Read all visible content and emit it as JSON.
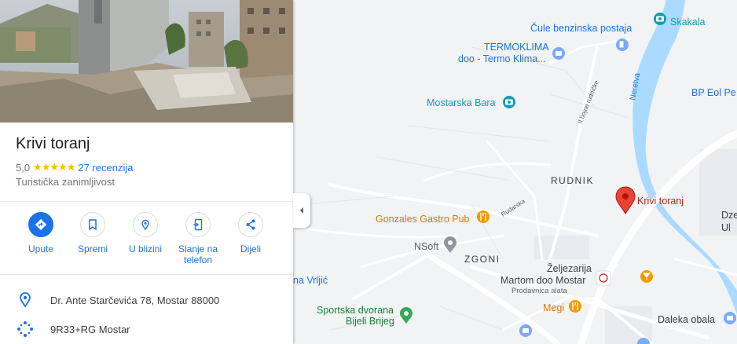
{
  "place": {
    "name": "Krivi toranj",
    "rating": "5,0",
    "stars": "★★★★★",
    "reviews": "27 recenzija",
    "category": "Turistička zanimljivost"
  },
  "actions": [
    {
      "label": "Upute",
      "icon": "directions-icon"
    },
    {
      "label": "Spremi",
      "icon": "bookmark-icon"
    },
    {
      "label": "U blizini",
      "icon": "nearby-icon"
    },
    {
      "label": "Slanje na telefon",
      "label_line1": "Slanje na",
      "label_line2": "telefon",
      "icon": "send-to-phone-icon"
    },
    {
      "label": "Dijeli",
      "icon": "share-icon"
    }
  ],
  "info": {
    "address": "Dr. Ante Starčevića 78, Mostar 88000",
    "plus_code": "9R33+RG Mostar"
  },
  "map_labels": {
    "cule": "Čule benzinska postaja",
    "skakala": "Skakala",
    "termoklima_1": "TERMOKLIMA",
    "termoklima_2": "doo - Termo Klima...",
    "bp_eol": "BP Eol Pe",
    "mostarska_bara": "Mostarska Bara",
    "neretva": "Neretva",
    "bojne_street": "II bojne rudničke",
    "rudnik": "RUDNIK",
    "krivi_toranj": "Krivi toranj",
    "gonzales": "Gonzales Gastro Pub",
    "rudarska": "Rudarska",
    "dze": "Dze",
    "ul": "Ul",
    "nsoft": "NSoft",
    "zgoni": "ZGONI",
    "zeljezarija": "Željezarija",
    "martom": "Martom doo Mostar",
    "prodavnica": "Prodavnica alata",
    "vrljic": "na Vrljić",
    "megi": "Megi",
    "sportska_1": "Sportska dvorana",
    "sportska_2": "Bijeli Brijeg",
    "daleka": "Daleka obala"
  },
  "colors": {
    "accent": "#1a73e8",
    "river": "#aadaff",
    "map_bg": "#f1f3f4",
    "road": "#ffffff",
    "poi_teal": "#129eaf",
    "poi_orange": "#f29900",
    "pin_red": "#ea4335",
    "park_green": "#34a853"
  }
}
